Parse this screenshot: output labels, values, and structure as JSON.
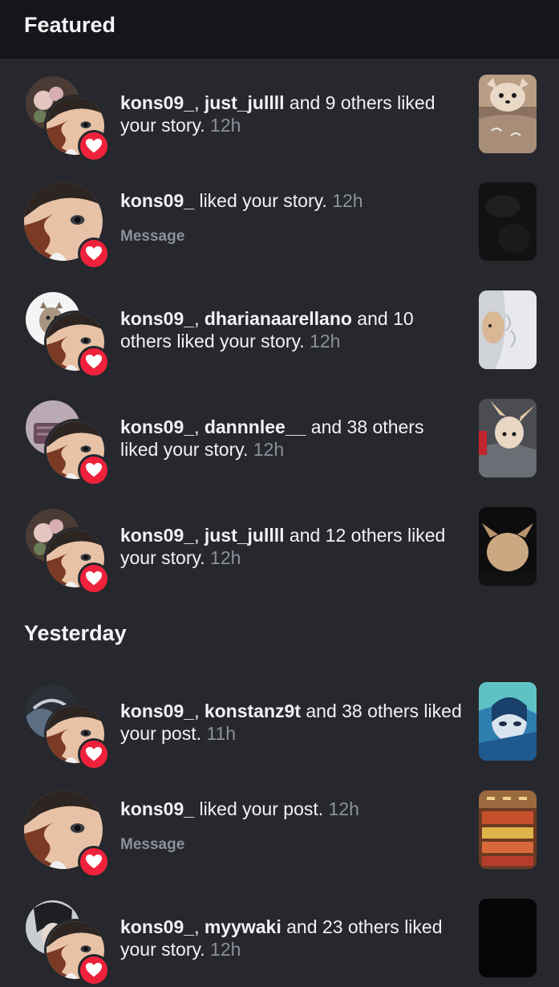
{
  "sections": {
    "featured": "Featured",
    "yesterday": "Yesterday"
  },
  "rows": [
    {
      "user1": "kons09_",
      "sep": ", ",
      "user2": "just_jullll",
      "rest": " and 9 others liked your story.",
      "time": "12h"
    },
    {
      "user1": "kons09_",
      "sep": "",
      "user2": "",
      "rest": " liked your story.",
      "time": "12h",
      "message": "Message"
    },
    {
      "user1": "kons09_",
      "sep": ", ",
      "user2": "dharianaarellano",
      "rest": " and 10 others liked your story.",
      "time": "12h"
    },
    {
      "user1": "kons09_",
      "sep": ", ",
      "user2": "dannnlee__",
      "rest": " and 38 others liked your story.",
      "time": "12h"
    },
    {
      "user1": "kons09_",
      "sep": ", ",
      "user2": "just_jullll",
      "rest": " and 12 others liked your story.",
      "time": "12h"
    },
    {
      "user1": "kons09_",
      "sep": ", ",
      "user2": "konstanz9t",
      "rest": " and 38 others liked your post.",
      "time": "11h"
    },
    {
      "user1": "kons09_",
      "sep": "",
      "user2": "",
      "rest": " liked your post.",
      "time": "12h",
      "message": "Message"
    },
    {
      "user1": "kons09_",
      "sep": ", ",
      "user2": "myywaki",
      "rest": " and 23 others liked your story.",
      "time": "12h"
    }
  ],
  "colors": {
    "background": "#26282e",
    "header": "#141619",
    "heart_badge": "#f0223b",
    "secondary_text": "#8d9099"
  },
  "icons": [
    "heart-icon"
  ]
}
